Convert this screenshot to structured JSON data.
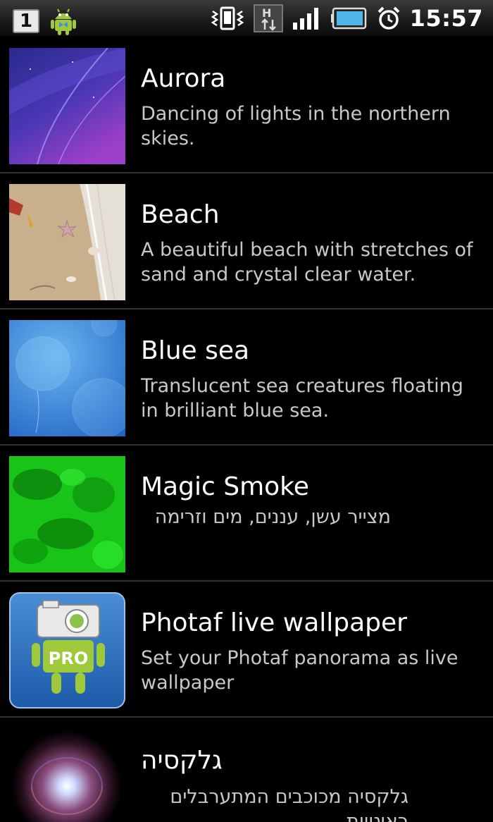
{
  "status_bar": {
    "notification_count": "1",
    "icons_left": [
      "notification-count-icon",
      "android-debug-icon"
    ],
    "icons_right": [
      "vibrate-icon",
      "hspa-data-icon",
      "signal-strength-icon",
      "battery-icon",
      "alarm-clock-icon"
    ],
    "time": "15:57"
  },
  "wallpapers": [
    {
      "title": "Aurora",
      "description": "Dancing of lights in the northern skies.",
      "thumbnail": "aurora-thumbnail"
    },
    {
      "title": "Beach",
      "description": "A beautiful beach with stretches of sand and crystal clear water.",
      "thumbnail": "beach-thumbnail"
    },
    {
      "title": "Blue sea",
      "description": "Translucent sea creatures floating in brilliant blue sea.",
      "thumbnail": "blue-sea-thumbnail"
    },
    {
      "title": "Magic Smoke",
      "description": "מצייר עשן, עננים, מים וזרימה",
      "thumbnail": "magic-smoke-thumbnail"
    },
    {
      "title": "Photaf live wallpaper",
      "description": "Set your Photaf panorama as live wallpaper",
      "thumbnail": "photaf-pro-thumbnail",
      "badge": "PRO"
    },
    {
      "title": "גלקסיה",
      "description": "גלקסיה מכוכבים המתערבלים ראיטיות",
      "thumbnail": "galaxy-thumbnail"
    }
  ]
}
